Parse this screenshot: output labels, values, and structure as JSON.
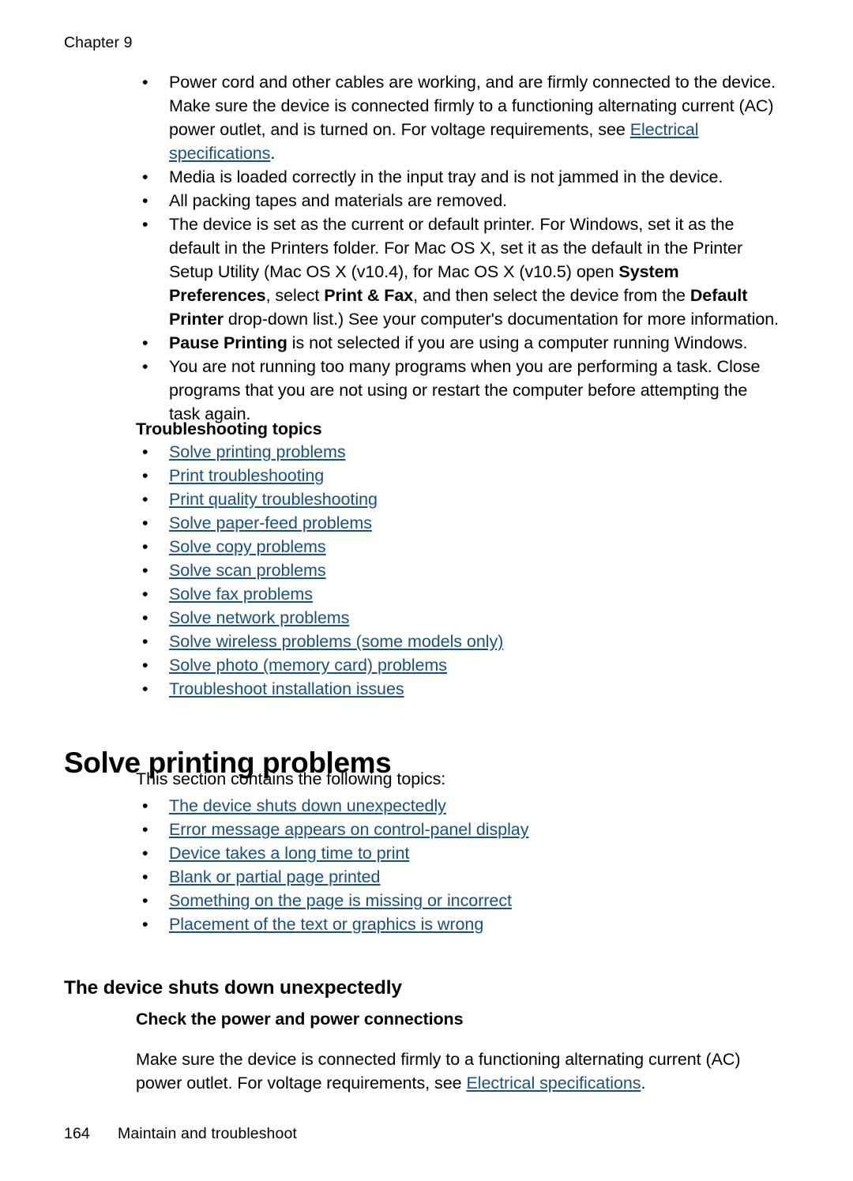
{
  "header": {
    "chapter_label": "Chapter 9"
  },
  "colors": {
    "link": "#1b4f7e",
    "text": "#000000",
    "page_background": "#ffffff"
  },
  "checklist": {
    "items": [
      {
        "segments": [
          {
            "type": "text",
            "text": "Power cord and other cables are working, and are firmly connected to the device. Make sure the device is connected firmly to a functioning alternating current (AC) power outlet, and is turned on. For voltage requirements, see "
          },
          {
            "type": "link",
            "text": "Electrical specifications"
          },
          {
            "type": "text",
            "text": "."
          }
        ]
      },
      {
        "segments": [
          {
            "type": "text",
            "text": "Media is loaded correctly in the input tray and is not jammed in the device."
          }
        ]
      },
      {
        "segments": [
          {
            "type": "text",
            "text": "All packing tapes and materials are removed."
          }
        ]
      },
      {
        "segments": [
          {
            "type": "text",
            "text": "The device is set as the current or default printer. For Windows, set it as the default in the Printers folder. For Mac OS X, set it as the default in the Printer Setup Utility (Mac OS X (v10.4), for Mac OS X (v10.5) open "
          },
          {
            "type": "bold",
            "text": "System Preferences"
          },
          {
            "type": "text",
            "text": ", select "
          },
          {
            "type": "bold",
            "text": "Print & Fax"
          },
          {
            "type": "text",
            "text": ", and then select the device from the "
          },
          {
            "type": "bold",
            "text": "Default Printer"
          },
          {
            "type": "text",
            "text": " drop-down list.) See your computer's documentation for more information."
          }
        ]
      },
      {
        "segments": [
          {
            "type": "bold",
            "text": "Pause Printing"
          },
          {
            "type": "text",
            "text": " is not selected if you are using a computer running Windows."
          }
        ]
      },
      {
        "segments": [
          {
            "type": "text",
            "text": "You are not running too many programs when you are performing a task. Close programs that you are not using or restart the computer before attempting the task again."
          }
        ]
      }
    ]
  },
  "troubleshooting_topics": {
    "heading": "Troubleshooting topics",
    "links": [
      "Solve printing problems",
      "Print troubleshooting",
      "Print quality troubleshooting",
      "Solve paper-feed problems",
      "Solve copy problems",
      "Solve scan problems",
      "Solve fax problems",
      "Solve network problems",
      "Solve wireless problems (some models only)",
      "Solve photo (memory card) problems",
      "Troubleshoot installation issues"
    ]
  },
  "solve_printing_problems": {
    "heading": "Solve printing problems",
    "intro": "This section contains the following topics:",
    "links": [
      "The device shuts down unexpectedly",
      "Error message appears on control-panel display",
      "Device takes a long time to print",
      "Blank or partial page printed",
      "Something on the page is missing or incorrect",
      "Placement of the text or graphics is wrong"
    ]
  },
  "device_shuts_down": {
    "heading": "The device shuts down unexpectedly",
    "subheading": "Check the power and power connections",
    "paragraph": {
      "segments": [
        {
          "type": "text",
          "text": "Make sure the device is connected firmly to a functioning alternating current (AC) power outlet. For voltage requirements, see "
        },
        {
          "type": "link",
          "text": "Electrical specifications"
        },
        {
          "type": "text",
          "text": "."
        }
      ]
    }
  },
  "footer": {
    "page_number": "164",
    "section_name": "Maintain and troubleshoot"
  },
  "bullet_glyph": "•"
}
